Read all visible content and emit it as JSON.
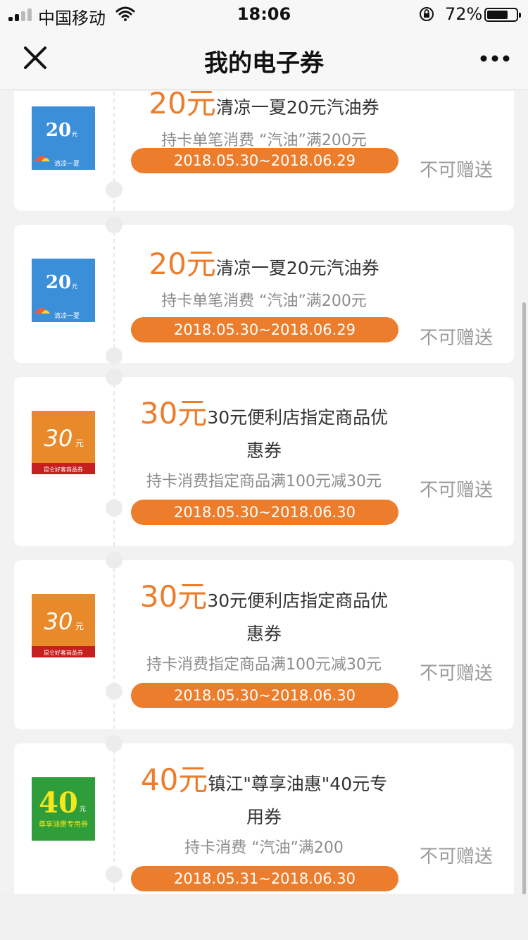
{
  "status_bar": {
    "carrier": "中国移动",
    "time": "18:06",
    "battery_percent_text": "72%",
    "battery_level": 0.72
  },
  "nav": {
    "title": "我的电子券",
    "close_icon": "close-icon",
    "more_icon": "more-dots-icon"
  },
  "colors": {
    "accent": "#ec7d2c",
    "bg": "#f2f2f2"
  },
  "coupons": [
    {
      "amount": "20元",
      "name": "清凉一夏20元汽油券",
      "condition": "持卡单笔消费 “汽油”满200元",
      "validity": "2018.05.30~2018.06.29",
      "status": "不可赠送",
      "thumb": {
        "value": "20",
        "unit": "元",
        "caption": "清凉一夏",
        "style": "blue"
      }
    },
    {
      "amount": "20元",
      "name": "清凉一夏20元汽油券",
      "condition": "持卡单笔消费 “汽油”满200元",
      "validity": "2018.05.30~2018.06.29",
      "status": "不可赠送",
      "thumb": {
        "value": "20",
        "unit": "元",
        "caption": "清凉一夏",
        "style": "blue"
      }
    },
    {
      "amount": "30元",
      "name_line1": "30元便利店指定商品优",
      "name_line2": "惠券",
      "condition": "持卡消费指定商品满100元减30元",
      "validity": "2018.05.30~2018.06.30",
      "status": "不可赠送",
      "thumb": {
        "value": "30",
        "unit": "元",
        "caption": "昆仑好客商品券",
        "style": "orange"
      }
    },
    {
      "amount": "30元",
      "name_line1": "30元便利店指定商品优",
      "name_line2": "惠券",
      "condition": "持卡消费指定商品满100元减30元",
      "validity": "2018.05.30~2018.06.30",
      "status": "不可赠送",
      "thumb": {
        "value": "30",
        "unit": "元",
        "caption": "昆仑好客商品券",
        "style": "orange"
      }
    },
    {
      "amount": "40元",
      "name_line1": "镇江\"尊享油惠\"40元专",
      "name_line2": "用券",
      "condition": "持卡消费 “汽油”满200",
      "validity": "2018.05.31~2018.06.30",
      "status": "不可赠送",
      "thumb": {
        "value": "40",
        "unit": "元",
        "caption": "尊享油惠专用券",
        "style": "green"
      }
    }
  ]
}
